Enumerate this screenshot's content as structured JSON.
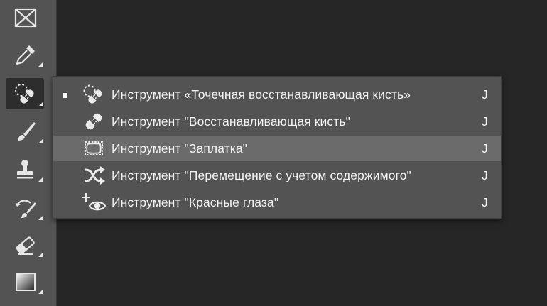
{
  "toolbar": {
    "tools": [
      {
        "name": "frame-tool",
        "icon": "frame-icon",
        "has_submenu": false,
        "active": false
      },
      {
        "name": "eyedropper-tool",
        "icon": "eyedropper-icon",
        "has_submenu": true,
        "active": false
      },
      {
        "name": "spot-healing-brush-tool",
        "icon": "spot-healing-brush-icon",
        "has_submenu": true,
        "active": true
      },
      {
        "name": "brush-tool",
        "icon": "brush-icon",
        "has_submenu": true,
        "active": false
      },
      {
        "name": "clone-stamp-tool",
        "icon": "stamp-icon",
        "has_submenu": true,
        "active": false
      },
      {
        "name": "history-brush-tool",
        "icon": "history-brush-icon",
        "has_submenu": true,
        "active": false
      },
      {
        "name": "eraser-tool",
        "icon": "eraser-icon",
        "has_submenu": true,
        "active": false
      },
      {
        "name": "gradient-tool",
        "icon": "gradient-icon",
        "has_submenu": true,
        "active": false
      }
    ]
  },
  "flyout": {
    "items": [
      {
        "label": "Инструмент «Точечная восстанавливающая кисть»",
        "shortcut": "J",
        "icon": "spot-healing-brush-icon",
        "selected": true,
        "hovered": false
      },
      {
        "label": "Инструмент \"Восстанавливающая кисть\"",
        "shortcut": "J",
        "icon": "healing-brush-icon",
        "selected": false,
        "hovered": false
      },
      {
        "label": "Инструмент \"Заплатка\"",
        "shortcut": "J",
        "icon": "patch-icon",
        "selected": false,
        "hovered": true
      },
      {
        "label": "Инструмент \"Перемещение с учетом содержимого\"",
        "shortcut": "J",
        "icon": "content-aware-move-icon",
        "selected": false,
        "hovered": false
      },
      {
        "label": "Инструмент \"Красные глаза\"",
        "shortcut": "J",
        "icon": "red-eye-icon",
        "selected": false,
        "hovered": false
      }
    ]
  },
  "colors": {
    "canvas_bg": "#262626",
    "panel_bg": "#535353",
    "hover_bg": "#6b6b6b",
    "text": "#f3f3f3"
  }
}
